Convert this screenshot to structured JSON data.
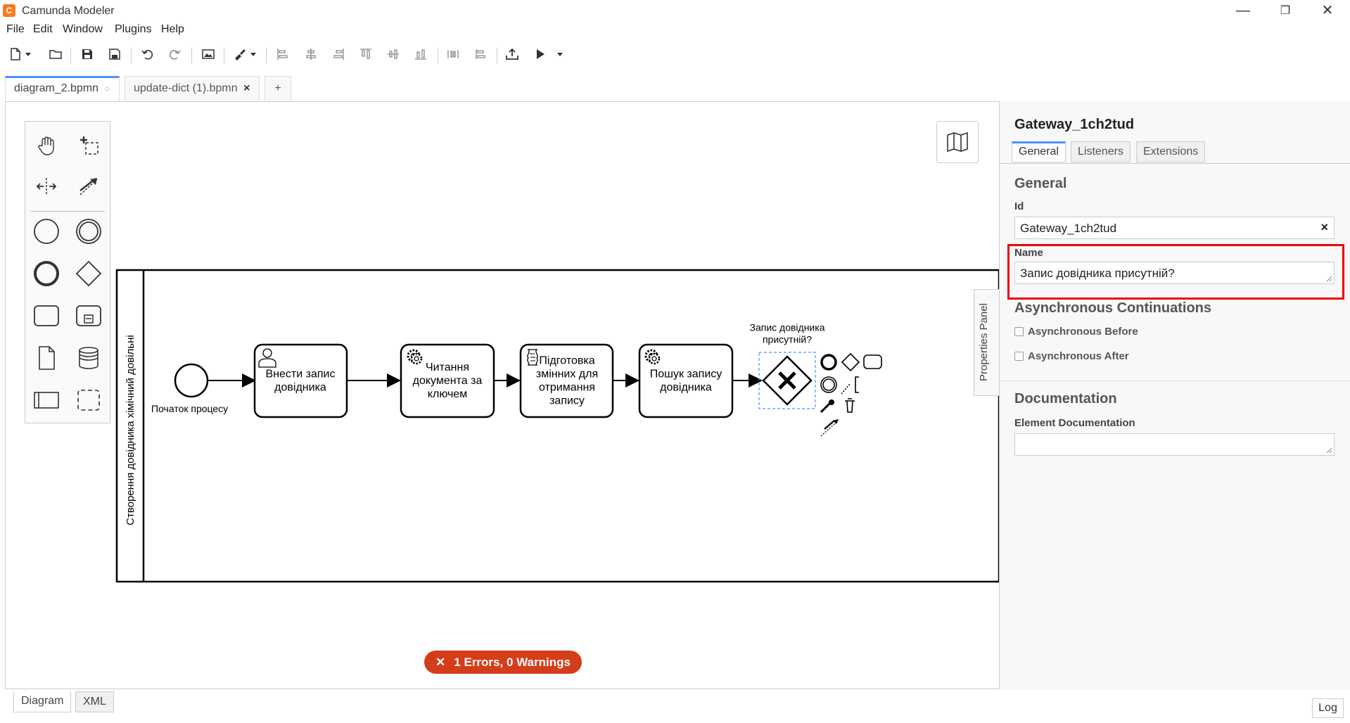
{
  "app": {
    "title": "Camunda Modeler",
    "logo_letter": "C"
  },
  "window_controls": {
    "minimize": "—",
    "restore": "❐",
    "close": "✕"
  },
  "menu": [
    "File",
    "Edit",
    "Window",
    "Plugins",
    "Help"
  ],
  "tabs": [
    {
      "label": "diagram_2.bpmn",
      "indicator": "○",
      "active": true
    },
    {
      "label": "update-dict (1).bpmn",
      "indicator": "×",
      "active": false
    }
  ],
  "add_tab_label": "+",
  "diagram": {
    "lane_label": "Створення довідника хімічний довільні",
    "start_event_label": "Початок процесу",
    "tasks": [
      {
        "label": "Внести запис довідника",
        "type": "user"
      },
      {
        "label": "Читання документа за ключем",
        "type": "service"
      },
      {
        "label": "Підготовка змінних для отримання запису",
        "type": "script"
      },
      {
        "label": "Пошук запису довідника",
        "type": "service"
      }
    ],
    "gateway_label": "Запис довідника присутній?"
  },
  "properties": {
    "toggle_label": "Properties Panel",
    "element_title": "Gateway_1ch2tud",
    "tabs": [
      "General",
      "Listeners",
      "Extensions"
    ],
    "active_tab": "General",
    "general_heading": "General",
    "id_label": "Id",
    "id_value": "Gateway_1ch2tud",
    "id_clear": "×",
    "name_label": "Name",
    "name_value": "Запис довідника присутній?",
    "async_heading": "Asynchronous Continuations",
    "async_before": "Asynchronous Before",
    "async_after": "Asynchronous After",
    "doc_heading": "Documentation",
    "doc_label": "Element Documentation",
    "doc_value": ""
  },
  "status": {
    "errors_label": "1 Errors, 0 Warnings",
    "errors_icon": "✕"
  },
  "bottom_tabs": [
    "Diagram",
    "XML"
  ],
  "log_label": "Log",
  "colors": {
    "accent": "#4d90fe",
    "error": "#d43d1a",
    "highlight": "#e00000",
    "logo": "#f47c20"
  }
}
